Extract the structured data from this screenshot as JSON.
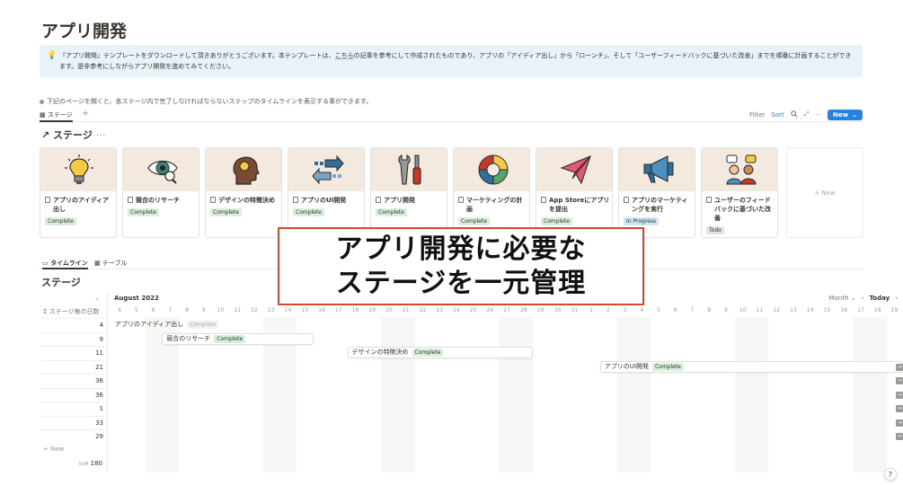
{
  "page": {
    "title": "アプリ開発"
  },
  "callout": {
    "icon": "lightbulb-emoji",
    "text_before": "『アプリ開発』テンプレートをダウンロードして頂きありがとうございます。本テンプレートは、",
    "link": "こちら",
    "text_after": "の記事を参考にして作成されたものであり、アプリの「アイディア出し」から「ローンチ」、そして「ユーザーフィードバックに基づいた改善」までを順番に計画することができます。是非参考にしながらアプリ開発を進めてみてください。"
  },
  "note": "下記のページを開くと、各ステージ内で完了しなければならないステップのタイムラインを表示する事ができます。",
  "gallery_view": {
    "tab_label": "ステージ",
    "add": "+",
    "toolbar": {
      "filter": "Filter",
      "sort": "Sort",
      "new": "New"
    },
    "db_title": "ステージ",
    "db_arrow": "↗",
    "db_more": "···",
    "new_card": "+ New",
    "cards": [
      {
        "title": "アプリのアイディア出し",
        "status": "Complete",
        "icon": "lightbulb-icon"
      },
      {
        "title": "競合のリサーチ",
        "status": "Complete",
        "icon": "eye-icon"
      },
      {
        "title": "デザインの特徴決め",
        "status": "Complete",
        "icon": "head-icon"
      },
      {
        "title": "アプリのUI開発",
        "status": "Complete",
        "icon": "arrows-icon"
      },
      {
        "title": "アプリ開発",
        "status": "Complete",
        "icon": "tools-icon"
      },
      {
        "title": "マーケティングの計画",
        "status": "Complete",
        "icon": "pie-chart-icon"
      },
      {
        "title": "App Storeにアプリを提出",
        "status": "Complete",
        "icon": "paper-plane-icon"
      },
      {
        "title": "アプリのマーケティングを実行",
        "status": "In Progress",
        "icon": "megaphone-icon"
      },
      {
        "title": "ユーザーのフィードバックに基づいた改善",
        "status": "Todo",
        "icon": "users-icon"
      }
    ]
  },
  "overlay": {
    "line1": "アプリ開発に必要な",
    "line2": "ステージを一元管理"
  },
  "timeline_view": {
    "tabs": [
      {
        "label": "タイムライン",
        "icon": "timeline-icon"
      },
      {
        "label": "テーブル",
        "icon": "table-icon"
      }
    ],
    "title": "ステージ",
    "collapse": "«",
    "sum_header": "Σ ステージ毎の日数",
    "month": "August 2022",
    "controls": {
      "scale": "Month",
      "prev": "‹",
      "today": "Today",
      "next": "›"
    },
    "days": [
      "4",
      "5",
      "6",
      "7",
      "8",
      "9",
      "10",
      "11",
      "12",
      "13",
      "14",
      "15",
      "16",
      "17",
      "18",
      "19",
      "20",
      "21",
      "22",
      "23",
      "24",
      "25",
      "26",
      "27",
      "28",
      "29",
      "30",
      "31",
      "1",
      "2",
      "3",
      "4",
      "5",
      "6",
      "7",
      "8",
      "9",
      "10",
      "11",
      "12",
      "13",
      "14",
      "15",
      "16",
      "17",
      "18",
      "19"
    ],
    "rows": [
      "4",
      "9",
      "11",
      "21",
      "36",
      "36",
      "1",
      "33",
      "29"
    ],
    "bars": [
      {
        "title": "アプリのアイディア出し",
        "status": "Complete"
      },
      {
        "title": "競合のリサーチ",
        "status": "Complete"
      },
      {
        "title": "デザインの特徴決め",
        "status": "Complete"
      },
      {
        "title": "アプリのUI開発",
        "status": "Complete"
      }
    ],
    "new": "+ New",
    "sum_label": "SUM",
    "sum_value": "180"
  },
  "help": "?"
}
